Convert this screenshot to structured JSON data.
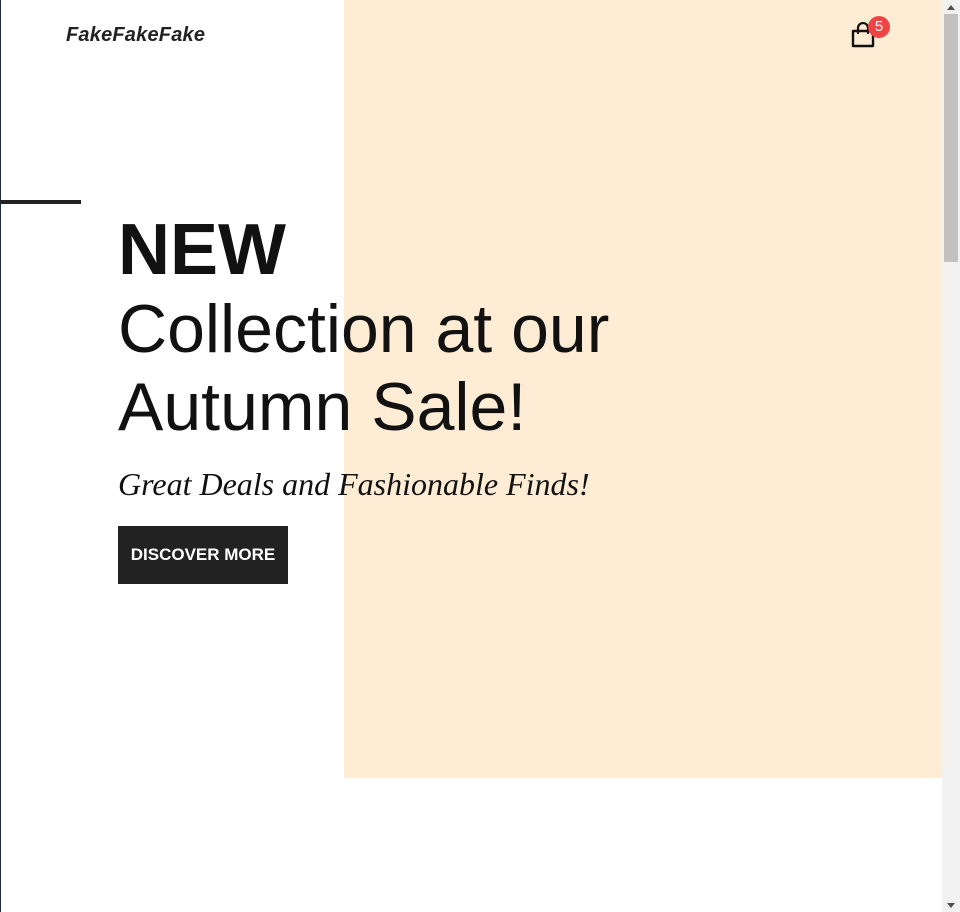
{
  "brand": {
    "logo_text": "FakeFakeFake"
  },
  "cart": {
    "icon": "shopping-bag-icon",
    "count": "5"
  },
  "hero": {
    "new_label": "NEW",
    "title": "Collection at our Autumn Sale!",
    "subtitle": "Great Deals and Fashionable Finds!",
    "cta_label": "DISCOVER MORE"
  },
  "colors": {
    "panel": "#ffecd5",
    "text": "#111111",
    "button_bg": "#222222",
    "badge": "#ee4444"
  }
}
